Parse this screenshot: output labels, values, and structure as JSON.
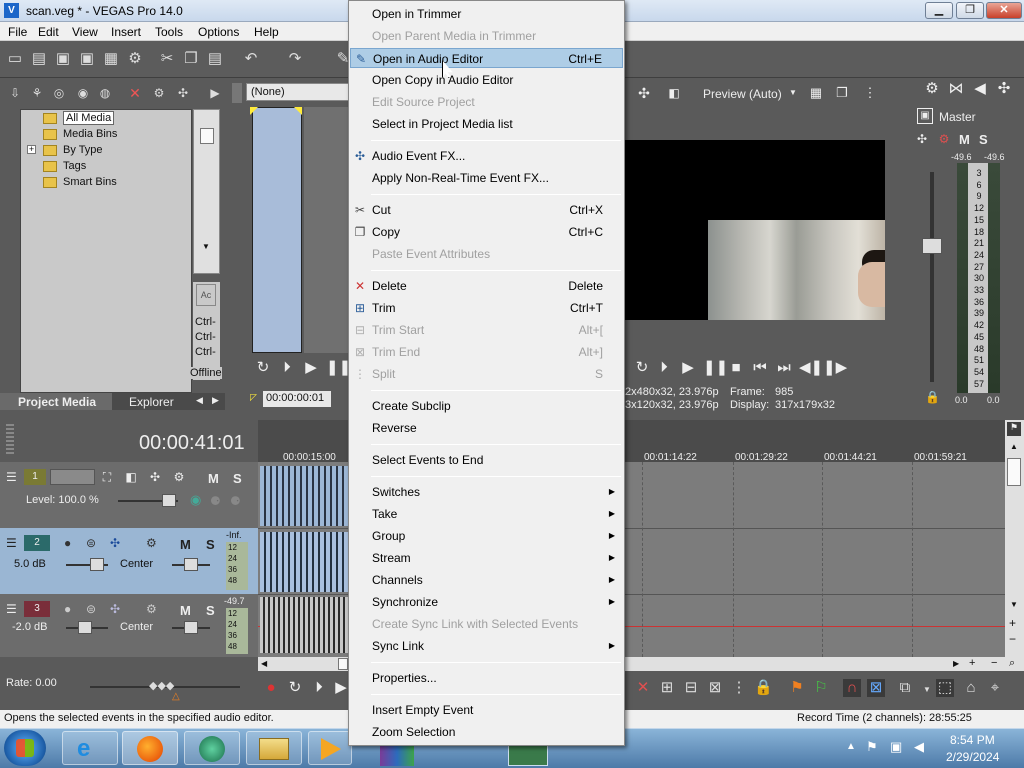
{
  "window": {
    "title": "scan.veg * - VEGAS Pro 14.0",
    "minimize": "▁",
    "maximize": "❐",
    "close": "✕"
  },
  "menubar": [
    "File",
    "Edit",
    "View",
    "Insert",
    "Tools",
    "Options",
    "Help"
  ],
  "media_panel": {
    "tree": [
      {
        "label": "All Media",
        "selected": true
      },
      {
        "label": "Media Bins"
      },
      {
        "label": "By Type",
        "expand": "+"
      },
      {
        "label": "Tags"
      },
      {
        "label": "Smart Bins"
      }
    ],
    "ctrl_labels": [
      "Ctrl-",
      "Ctrl-",
      "Ctrl-"
    ],
    "offline_label": "Offline",
    "tabs": [
      "Project Media",
      "Explorer"
    ]
  },
  "trimmer": {
    "dropdown_value": "(None)",
    "timecode": "00:00:00:01"
  },
  "preview": {
    "mode": "Preview (Auto)",
    "info_left_1": "2x480x32, 23.976p",
    "info_left_2": "3x120x32, 23.976p",
    "frame_label": "Frame:",
    "frame_value": "985",
    "display_label": "Display:",
    "display_value": "317x179x32"
  },
  "mixer": {
    "title": "Master",
    "m_label": "M",
    "s_label": "S",
    "peak_left": "-49.6",
    "peak_right": "-49.6",
    "scale": [
      "3",
      "6",
      "9",
      "12",
      "15",
      "18",
      "21",
      "24",
      "27",
      "30",
      "33",
      "36",
      "39",
      "42",
      "45",
      "48",
      "51",
      "54",
      "57"
    ],
    "bottom_left": "0.0",
    "bottom_right": "0.0"
  },
  "timeline": {
    "timecode": "00:00:41:01",
    "ruler": [
      "00:00:15:00",
      "00:01:14:22",
      "00:01:29:22",
      "00:01:44:21",
      "00:01:59:21"
    ],
    "tracks": [
      {
        "number": "1",
        "level_label": "Level: 100.0 %",
        "m": "M",
        "s": "S"
      },
      {
        "number": "2",
        "volume": "5.0 dB",
        "pan": "Center",
        "m": "M",
        "s": "S",
        "meter_top": "-Inf.",
        "meter_scale": [
          "12",
          "24",
          "36",
          "48"
        ]
      },
      {
        "number": "3",
        "volume": "-2.0 dB",
        "pan": "Center",
        "m": "M",
        "s": "S",
        "meter_top": "-49.7",
        "meter_scale": [
          "12",
          "24",
          "36",
          "48"
        ]
      }
    ],
    "rate_label": "Rate: 0.00"
  },
  "context_menu": {
    "items": [
      {
        "label": "Open in Trimmer",
        "shortcut": "",
        "disabled": false
      },
      {
        "label": "Open Parent Media in Trimmer",
        "shortcut": "",
        "disabled": true
      },
      {
        "label": "Open in Audio Editor",
        "shortcut": "Ctrl+E",
        "disabled": false,
        "highlighted": true,
        "icon": "audio-editor-icon"
      },
      {
        "label": "Open Copy in Audio Editor",
        "shortcut": "",
        "disabled": false
      },
      {
        "label": "Edit Source Project",
        "shortcut": "",
        "disabled": true
      },
      {
        "label": "Select in Project Media list",
        "shortcut": "",
        "disabled": false
      },
      {
        "sep": true
      },
      {
        "label": "Audio Event FX...",
        "shortcut": "",
        "disabled": false,
        "icon": "fx-icon"
      },
      {
        "label": "Apply Non-Real-Time Event FX...",
        "shortcut": "",
        "disabled": false
      },
      {
        "sep": true
      },
      {
        "label": "Cut",
        "shortcut": "Ctrl+X",
        "disabled": false,
        "icon": "scissors-icon"
      },
      {
        "label": "Copy",
        "shortcut": "Ctrl+C",
        "disabled": false,
        "icon": "copy-icon"
      },
      {
        "label": "Paste Event Attributes",
        "shortcut": "",
        "disabled": true
      },
      {
        "sep": true
      },
      {
        "label": "Delete",
        "shortcut": "Delete",
        "disabled": false,
        "icon": "delete-icon"
      },
      {
        "label": "Trim",
        "shortcut": "Ctrl+T",
        "disabled": false,
        "icon": "trim-icon"
      },
      {
        "label": "Trim Start",
        "shortcut": "Alt+[",
        "disabled": true,
        "icon": "trim-start-icon"
      },
      {
        "label": "Trim End",
        "shortcut": "Alt+]",
        "disabled": true,
        "icon": "trim-end-icon"
      },
      {
        "label": "Split",
        "shortcut": "S",
        "disabled": true,
        "icon": "split-icon"
      },
      {
        "sep": true
      },
      {
        "label": "Create Subclip",
        "shortcut": "",
        "disabled": false
      },
      {
        "label": "Reverse",
        "shortcut": "",
        "disabled": false
      },
      {
        "sep": true
      },
      {
        "label": "Select Events to End",
        "shortcut": "",
        "disabled": false
      },
      {
        "sep": true
      },
      {
        "label": "Switches",
        "shortcut": "",
        "disabled": false,
        "submenu": true
      },
      {
        "label": "Take",
        "shortcut": "",
        "disabled": false,
        "submenu": true
      },
      {
        "label": "Group",
        "shortcut": "",
        "disabled": false,
        "submenu": true
      },
      {
        "label": "Stream",
        "shortcut": "",
        "disabled": false,
        "submenu": true
      },
      {
        "label": "Channels",
        "shortcut": "",
        "disabled": false,
        "submenu": true
      },
      {
        "label": "Synchronize",
        "shortcut": "",
        "disabled": false,
        "submenu": true
      },
      {
        "label": "Create Sync Link with Selected Events",
        "shortcut": "",
        "disabled": true
      },
      {
        "label": "Sync Link",
        "shortcut": "",
        "disabled": false,
        "submenu": true
      },
      {
        "sep": true
      },
      {
        "label": "Properties...",
        "shortcut": "",
        "disabled": false
      },
      {
        "sep": true
      },
      {
        "label": "Insert Empty Event",
        "shortcut": "",
        "disabled": false
      },
      {
        "label": "Zoom Selection",
        "shortcut": "",
        "disabled": false
      }
    ]
  },
  "statusbar": {
    "left": "Opens the selected events in the specified audio editor.",
    "right": "Record Time (2 channels): 28:55:25"
  },
  "taskbar": {
    "time": "8:54 PM",
    "date": "2/29/2024"
  }
}
